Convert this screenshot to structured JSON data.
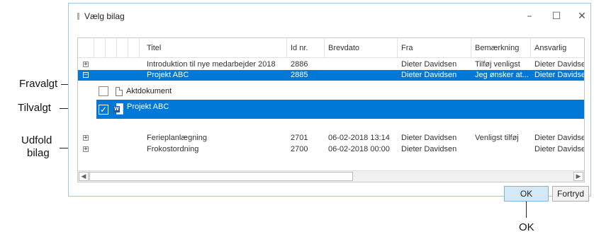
{
  "window": {
    "title": "Vælg bilag",
    "minimize": "–",
    "maximize": "☐",
    "close": "✕"
  },
  "grid": {
    "columns": [
      "Titel",
      "Id nr.",
      "Brevdato",
      "Fra",
      "Bemærkning",
      "Ansvarlig"
    ],
    "rows": [
      {
        "expander": "+",
        "title": "Introduktion til nye medarbejder 2018",
        "id": "2886",
        "date": "",
        "from": "Dieter Davidsen",
        "note": "Tilføj venligst",
        "owner": "Dieter Davidsen",
        "selected": false
      },
      {
        "expander": "−",
        "title": "Projekt ABC",
        "id": "2885",
        "date": "",
        "from": "Dieter Davidsen",
        "note": "Jeg ønsker at...",
        "owner": "Dieter Davidsen",
        "selected": true
      }
    ],
    "attachments": [
      {
        "label": "Aktdokument",
        "checked": false,
        "icon": "document-icon"
      },
      {
        "label": "Projekt ABC",
        "checked": true,
        "icon": "word-document-icon"
      }
    ],
    "rows_after": [
      {
        "expander": "+",
        "title": "Ferieplanlægning",
        "id": "2701",
        "date": "06-02-2018 13:14",
        "from": "Dieter Davidsen",
        "note": "Venligst tilføj",
        "owner": "Dieter Davidsen"
      },
      {
        "expander": "+",
        "title": "Frokostordning",
        "id": "2700",
        "date": "06-02-2018 00:00",
        "from": "Dieter Davidsen",
        "note": "",
        "owner": "Dieter Davidsen"
      }
    ]
  },
  "buttons": {
    "ok": "OK",
    "cancel": "Fortryd"
  },
  "annotations": {
    "fravalgt": "Fravalgt",
    "tilvalgt": "Tilvalgt",
    "udfold_line1": "Udfold",
    "udfold_line2": "bilag",
    "ok": "OK"
  },
  "colors": {
    "selection": "#0078d7",
    "ok_button": "#d5e8f8"
  }
}
